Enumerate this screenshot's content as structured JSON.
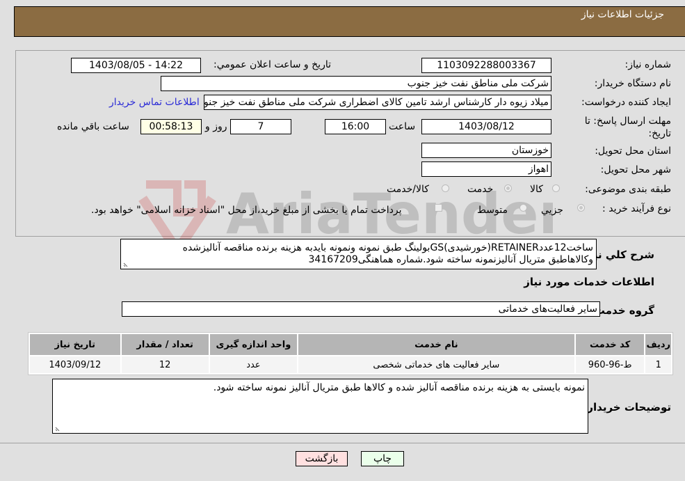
{
  "header": {
    "title": "جزئیات اطلاعات نیاز"
  },
  "form": {
    "need_number_label": "شماره نیاز:",
    "need_number": "1103092288003367",
    "announce_label": "تاریخ و ساعت اعلان عمومي:",
    "announce_value": "1403/08/05 - 14:22",
    "buyer_org_label": "نام دستگاه خريدار:",
    "buyer_org": "شرکت ملی مناطق نفت خیز جنوب",
    "creator_label": "ایجاد کننده درخواست:",
    "creator": "میلاد زیوه دار  کارشناس ارشد تامین کالای اضطراری شرکت ملی مناطق نفت خیز جنوب",
    "contact_link": "اطلاعات تماس خريدار",
    "deadline_label": "مهلت ارسال پاسخ: تا تاریخ:",
    "deadline_date": "1403/08/12",
    "time_label": "ساعت",
    "deadline_time": "16:00",
    "days_value": "7",
    "days_label": "روز و",
    "remaining_time": "00:58:13",
    "remaining_label": "ساعت باقي مانده",
    "province_label": "استان محل تحویل:",
    "province": "خوزستان",
    "city_label": "شهر محل تحویل:",
    "city": "اهواز",
    "category_label": "طبقه بندی موضوعی:",
    "category_options": [
      {
        "label": "کالا",
        "checked": false
      },
      {
        "label": "خدمت",
        "checked": true
      },
      {
        "label": "کالا/خدمت",
        "checked": false
      }
    ],
    "process_label": "نوع فرآیند خرید :",
    "process_options": [
      {
        "label": "جزيي",
        "checked": true
      },
      {
        "label": "متوسط",
        "checked": false
      }
    ],
    "treasury_checkbox_label": "پرداخت تمام یا بخشی از مبلغ خرید،از محل \"اسناد خزانه اسلامی\" خواهد بود.",
    "treasury_checked": false
  },
  "description": {
    "label": "شرح کلي نياز:",
    "line1": "ساخت12عددRETAINER(خورشیدی)GSبولینگ طبق نمونه ونمونه بایدبه هزینه برنده مناقصه آنالیزشده",
    "line2": "وکالاهاطبق متریال آنالیزنمونه ساخته شود.شماره هماهنگی34167209"
  },
  "services": {
    "section_title": "اطلاعات خدمات مورد نياز",
    "group_label": "گروه خدمت:",
    "group_value": "سایر فعالیت‌های خدماتی",
    "table": {
      "headers": [
        "ردیف",
        "کد خدمت",
        "نام خدمت",
        "واحد اندازه گیری",
        "تعداد / مقدار",
        "تاریخ نیاز"
      ],
      "rows": [
        [
          "1",
          "ط-96-960",
          "سایر فعالیت های خدماتی شخصی",
          "عدد",
          "12",
          "1403/09/12"
        ]
      ]
    }
  },
  "buyer_notes": {
    "label": "توضیحات خریدار:",
    "text": "نمونه بایستی به هزینه برنده مناقصه آنالیز شده و کالاها طبق متریال آنالیز نمونه ساخته شود."
  },
  "buttons": {
    "print": "چاپ",
    "back": "بازگشت"
  },
  "colors": {
    "header_bg": "#8b6c42",
    "link": "#2b2bd6",
    "print_bg": "#eaffea",
    "back_bg": "#ffe0e0",
    "remaining_bg": "#ffffe6"
  }
}
